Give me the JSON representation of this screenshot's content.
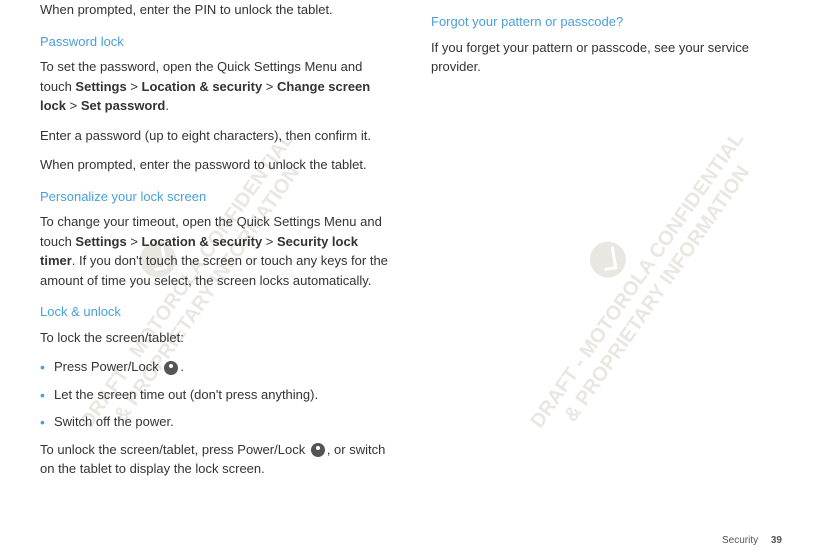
{
  "left": {
    "intro": "When prompted, enter the PIN to unlock the tablet.",
    "h1": "Password lock",
    "p1_pre": "To set the password, open the Quick Settings Menu and touch ",
    "p1_b1": "Settings",
    "p1_gt1": " > ",
    "p1_b2": "Location & security",
    "p1_gt2": " > ",
    "p1_b3": "Change screen lock",
    "p1_gt3": " > ",
    "p1_b4": "Set password",
    "p1_end": ".",
    "p2": "Enter a password (up to eight characters), then confirm it.",
    "p3": "When prompted, enter the password to unlock the tablet.",
    "h2": "Personalize your lock screen",
    "p4_pre": "To change your timeout, open the Quick Settings Menu and touch ",
    "p4_b1": "Settings",
    "p4_gt1": " > ",
    "p4_b2": "Location & security",
    "p4_gt2": " > ",
    "p4_b3": "Security lock timer",
    "p4_end": ". If you don't touch the screen or touch any keys for the amount of time you select, the screen locks automatically.",
    "h3": "Lock & unlock",
    "p5": "To lock the screen/tablet:",
    "li1_pre": "Press Power/Lock ",
    "li1_end": ".",
    "li2": "Let the screen time out (don't press anything).",
    "li3": "Switch off the power.",
    "p6_pre": "To unlock the screen/tablet, press Power/Lock ",
    "p6_end": ", or switch on the tablet to display the lock screen."
  },
  "right": {
    "h1": "Forgot your pattern or passcode?",
    "p1": "If you forget your pattern or passcode, see your service provider."
  },
  "watermark": {
    "line1": "DRAFT - MOTOROLA CONFIDENTIAL",
    "line2": "& PROPRIETARY INFORMATION"
  },
  "footer": {
    "section": "Security",
    "page": "39"
  }
}
